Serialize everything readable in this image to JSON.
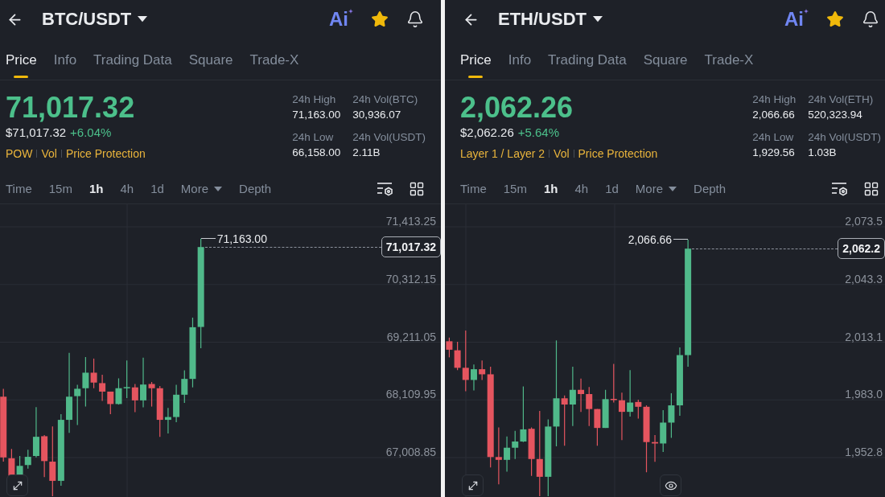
{
  "panels": [
    {
      "pair": "BTC/USDT",
      "ai_label": "Ai",
      "favorited": true,
      "tabs": [
        {
          "label": "Price",
          "selected": true
        },
        {
          "label": "Info",
          "selected": false
        },
        {
          "label": "Trading Data",
          "selected": false
        },
        {
          "label": "Square",
          "selected": false
        },
        {
          "label": "Trade-X",
          "selected": false
        }
      ],
      "rising": true,
      "last_price": "71,017.32",
      "usd_price": "$71,017.32",
      "change": "+6.04%",
      "tags": [
        "POW",
        "Vol",
        "Price Protection"
      ],
      "stats": [
        {
          "label": "24h High",
          "value": "71,163.00"
        },
        {
          "label": "24h Vol(BTC)",
          "value": "30,936.07"
        },
        {
          "label": "24h Low",
          "value": "66,158.00"
        },
        {
          "label": "24h Vol(USDT)",
          "value": "2.11B"
        }
      ],
      "intervals": [
        {
          "label": "Time",
          "kind": "option",
          "selected": false
        },
        {
          "label": "15m",
          "kind": "option",
          "selected": false
        },
        {
          "label": "1h",
          "kind": "option",
          "selected": true
        },
        {
          "label": "4h",
          "kind": "option",
          "selected": false
        },
        {
          "label": "1d",
          "kind": "option",
          "selected": false
        },
        {
          "label": "More",
          "kind": "dropdown",
          "selected": false
        },
        {
          "label": "Depth",
          "kind": "option",
          "selected": false
        }
      ],
      "chart": {
        "y_axis_labels": [
          "71,413.25",
          "70,312.15",
          "69,211.05",
          "68,109.95",
          "67,008.85"
        ],
        "high_label": "71,163.00",
        "current_price": "71,017.32",
        "buttons": [
          {
            "kind": "expand"
          }
        ]
      }
    },
    {
      "pair": "ETH/USDT",
      "ai_label": "Ai",
      "favorited": true,
      "tabs": [
        {
          "label": "Price",
          "selected": true
        },
        {
          "label": "Info",
          "selected": false
        },
        {
          "label": "Trading Data",
          "selected": false
        },
        {
          "label": "Square",
          "selected": false
        },
        {
          "label": "Trade-X",
          "selected": false
        }
      ],
      "rising": true,
      "last_price": "2,062.26",
      "usd_price": "$2,062.26",
      "change": "+5.64%",
      "tags": [
        "Layer 1 / Layer 2",
        "Vol",
        "Price Protection"
      ],
      "stats": [
        {
          "label": "24h High",
          "value": "2,066.66"
        },
        {
          "label": "24h Vol(ETH)",
          "value": "520,323.94"
        },
        {
          "label": "24h Low",
          "value": "1,929.56"
        },
        {
          "label": "24h Vol(USDT)",
          "value": "1.03B"
        }
      ],
      "intervals": [
        {
          "label": "Time",
          "kind": "option",
          "selected": false
        },
        {
          "label": "15m",
          "kind": "option",
          "selected": false
        },
        {
          "label": "1h",
          "kind": "option",
          "selected": true
        },
        {
          "label": "4h",
          "kind": "option",
          "selected": false
        },
        {
          "label": "1d",
          "kind": "option",
          "selected": false
        },
        {
          "label": "More",
          "kind": "dropdown",
          "selected": false
        },
        {
          "label": "Depth",
          "kind": "option",
          "selected": false
        }
      ],
      "chart": {
        "y_axis_labels": [
          "2,073.5",
          "2,043.3",
          "2,013.1",
          "1,983.0",
          "1,952.8"
        ],
        "high_label": "2,066.66",
        "current_price": "2,062.2",
        "buttons": [
          {
            "kind": "expand"
          },
          {
            "kind": "eye"
          }
        ]
      }
    }
  ]
}
